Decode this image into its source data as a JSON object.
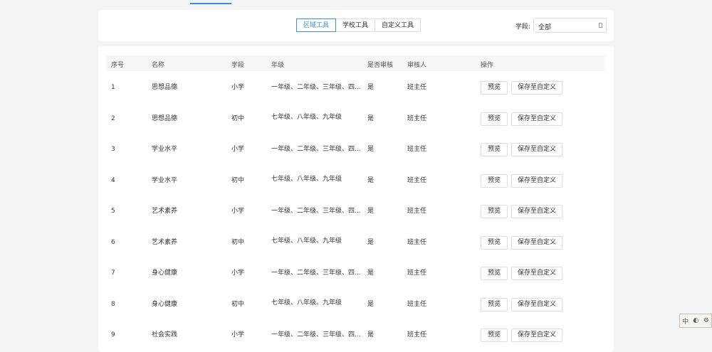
{
  "tabs": [
    {
      "label": "区域工具",
      "active": true
    },
    {
      "label": "学校工具",
      "active": false
    },
    {
      "label": "自定义工具",
      "active": false
    }
  ],
  "filter": {
    "label": "学段:",
    "value": "全部"
  },
  "table": {
    "columns": [
      "序号",
      "名称",
      "学段",
      "年级",
      "是否审核",
      "审核人",
      "操作"
    ],
    "rows": [
      {
        "index": "1",
        "name": "思想品德",
        "stage": "小学",
        "grades": "一年级、二年级、三年级、四...",
        "reviewed": "是",
        "reviewer": "班主任"
      },
      {
        "index": "2",
        "name": "思想品德",
        "stage": "初中",
        "grades": "七年级、八年级、九年级",
        "reviewed": "是",
        "reviewer": "班主任"
      },
      {
        "index": "3",
        "name": "学业水平",
        "stage": "小学",
        "grades": "一年级、二年级、三年级、四...",
        "reviewed": "是",
        "reviewer": "班主任"
      },
      {
        "index": "4",
        "name": "学业水平",
        "stage": "初中",
        "grades": "七年级、八年级、九年级",
        "reviewed": "是",
        "reviewer": "班主任"
      },
      {
        "index": "5",
        "name": "艺术素养",
        "stage": "小学",
        "grades": "一年级、二年级、三年级、四...",
        "reviewed": "是",
        "reviewer": "班主任"
      },
      {
        "index": "6",
        "name": "艺术素养",
        "stage": "初中",
        "grades": "七年级、八年级、九年级",
        "reviewed": "是",
        "reviewer": "班主任"
      },
      {
        "index": "7",
        "name": "身心健康",
        "stage": "小学",
        "grades": "一年级、二年级、三年级、四...",
        "reviewed": "是",
        "reviewer": "班主任"
      },
      {
        "index": "8",
        "name": "身心健康",
        "stage": "初中",
        "grades": "七年级、八年级、九年级",
        "reviewed": "是",
        "reviewer": "班主任"
      },
      {
        "index": "9",
        "name": "社会实践",
        "stage": "小学",
        "grades": "一年级、二年级、三年级、四...",
        "reviewed": "是",
        "reviewer": "班主任"
      }
    ],
    "actions": {
      "preview": "预览",
      "save": "保存至自定义"
    }
  },
  "ime": {
    "chars": [
      "中",
      "◐",
      "⚙"
    ]
  },
  "colors": {
    "accent": "#3a8ee6",
    "background": "#f3f4f6"
  }
}
